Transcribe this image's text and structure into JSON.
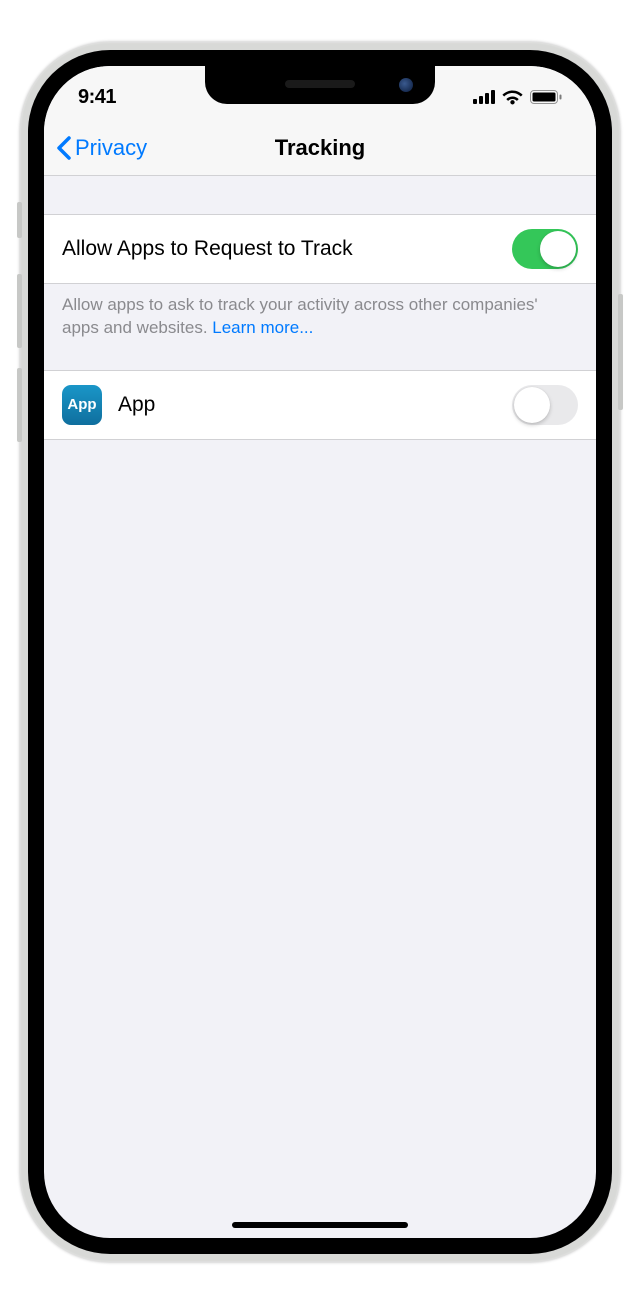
{
  "status": {
    "time": "9:41"
  },
  "nav": {
    "back_label": "Privacy",
    "title": "Tracking"
  },
  "settings": {
    "allow_track": {
      "label": "Allow Apps to Request to Track",
      "enabled": true
    },
    "footer": {
      "text": "Allow apps to ask to track your activity across other companies' apps and websites. ",
      "link_text": "Learn more..."
    },
    "apps": [
      {
        "name": "App",
        "icon_label": "App",
        "enabled": false
      }
    ]
  }
}
